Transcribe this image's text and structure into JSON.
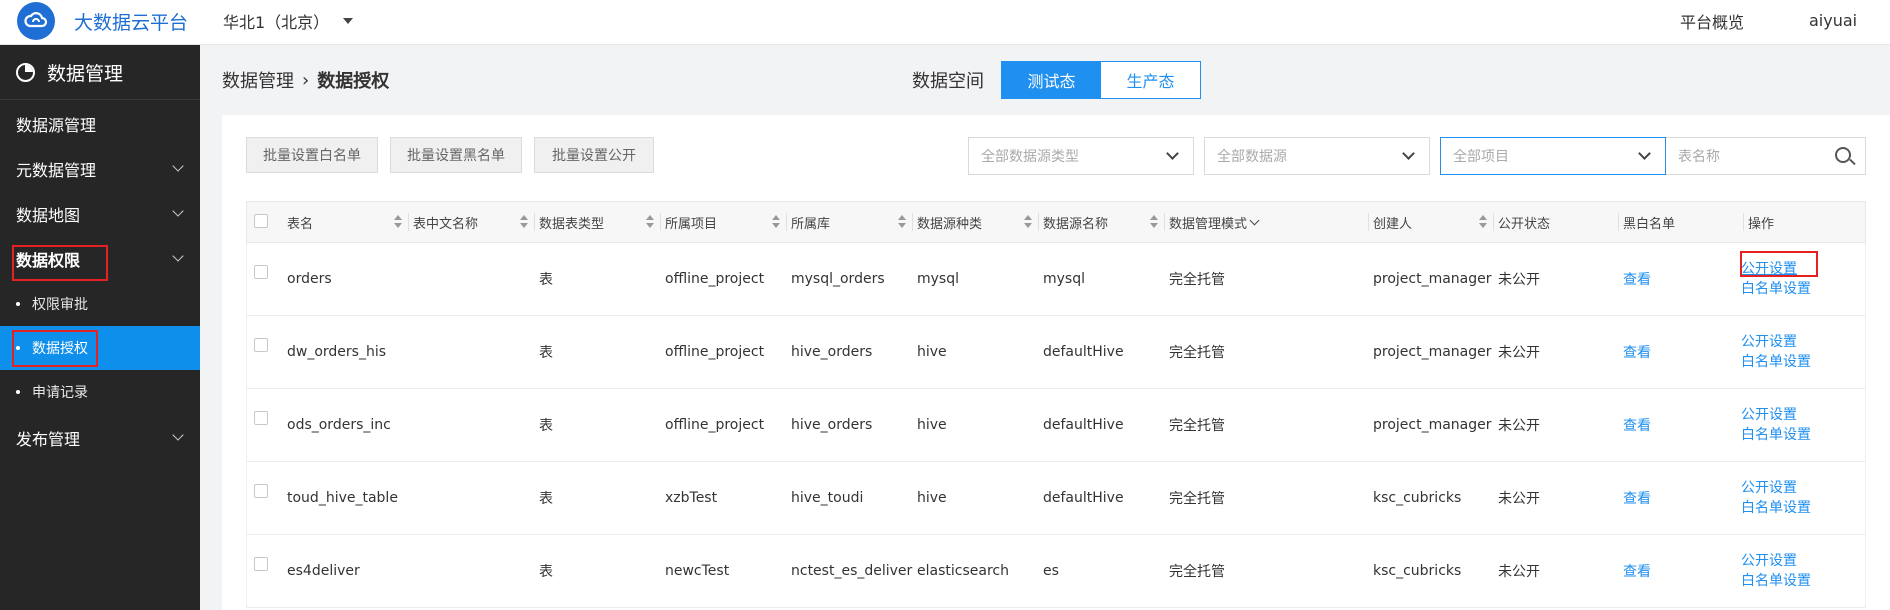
{
  "header": {
    "brand": "大数据云平台",
    "region": "华北1（北京）",
    "overview": "平台概览",
    "user": "aiyuai"
  },
  "sidebar": {
    "title": "数据管理",
    "items": [
      {
        "label": "数据源管理"
      },
      {
        "label": "元数据管理"
      },
      {
        "label": "数据地图"
      },
      {
        "label": "数据权限"
      },
      {
        "label": "权限审批"
      },
      {
        "label": "数据授权"
      },
      {
        "label": "申请记录"
      },
      {
        "label": "发布管理"
      }
    ]
  },
  "breadcrumb": {
    "parent": "数据管理",
    "sep": "›",
    "current": "数据授权"
  },
  "space": {
    "label": "数据空间",
    "test": "测试态",
    "prod": "生产态"
  },
  "toolbar": {
    "whitelist": "批量设置白名单",
    "blacklist": "批量设置黑名单",
    "public": "批量设置公开",
    "ds_type": "全部数据源类型",
    "ds": "全部数据源",
    "project": "全部项目",
    "search_placeholder": "表名称"
  },
  "table": {
    "columns": [
      "表名",
      "表中文名称",
      "数据表类型",
      "所属项目",
      "所属库",
      "数据源种类",
      "数据源名称",
      "数据管理模式",
      "创建人",
      "公开状态",
      "黑白名单",
      "操作"
    ],
    "rows": [
      {
        "name": "orders",
        "cn": "",
        "type": "表",
        "project": "offline_project",
        "db": "mysql_orders",
        "kind": "mysql",
        "ds": "mysql",
        "mode": "完全托管",
        "creator": "project_manager",
        "status": "未公开",
        "bw": "查看",
        "op1": "公开设置",
        "op2": "白名单设置"
      },
      {
        "name": "dw_orders_his",
        "cn": "",
        "type": "表",
        "project": "offline_project",
        "db": "hive_orders",
        "kind": "hive",
        "ds": "defaultHive",
        "mode": "完全托管",
        "creator": "project_manager",
        "status": "未公开",
        "bw": "查看",
        "op1": "公开设置",
        "op2": "白名单设置"
      },
      {
        "name": "ods_orders_inc",
        "cn": "",
        "type": "表",
        "project": "offline_project",
        "db": "hive_orders",
        "kind": "hive",
        "ds": "defaultHive",
        "mode": "完全托管",
        "creator": "project_manager",
        "status": "未公开",
        "bw": "查看",
        "op1": "公开设置",
        "op2": "白名单设置"
      },
      {
        "name": "toud_hive_table",
        "cn": "",
        "type": "表",
        "project": "xzbTest",
        "db": "hive_toudi",
        "kind": "hive",
        "ds": "defaultHive",
        "mode": "完全托管",
        "creator": "ksc_cubricks",
        "status": "未公开",
        "bw": "查看",
        "op1": "公开设置",
        "op2": "白名单设置"
      },
      {
        "name": "es4deliver",
        "cn": "",
        "type": "表",
        "project": "newcTest",
        "db": "nctest_es_deliver",
        "kind": "elasticsearch",
        "ds": "es",
        "mode": "完全托管",
        "creator": "ksc_cubricks",
        "status": "未公开",
        "bw": "查看",
        "op1": "公开设置",
        "op2": "白名单设置"
      }
    ]
  },
  "colors": {
    "accent": "#1f8ff0",
    "brand": "#1f6ed4",
    "sidebar": "#262626",
    "highlight": "#e52121"
  }
}
